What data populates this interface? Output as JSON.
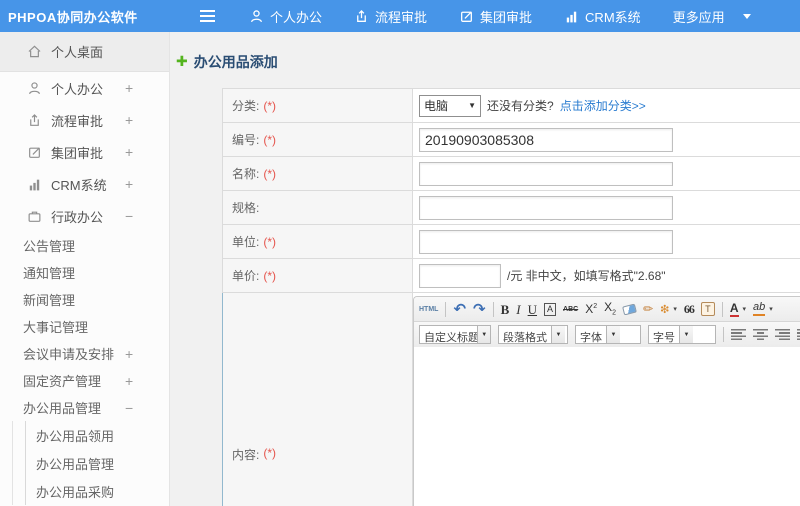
{
  "header": {
    "logo": "PHPOA协同办公软件",
    "nav": [
      {
        "label": "个人办公"
      },
      {
        "label": "流程审批"
      },
      {
        "label": "集团审批"
      },
      {
        "label": "CRM系统"
      },
      {
        "label": "更多应用"
      }
    ]
  },
  "sidebar": {
    "items": [
      {
        "label": "个人桌面",
        "expander": ""
      },
      {
        "label": "个人办公",
        "expander": "+"
      },
      {
        "label": "流程审批",
        "expander": "+"
      },
      {
        "label": "集团审批",
        "expander": "+"
      },
      {
        "label": "CRM系统",
        "expander": "+"
      },
      {
        "label": "行政办公",
        "expander": "−"
      }
    ],
    "admin_children": [
      {
        "label": "公告管理",
        "expander": ""
      },
      {
        "label": "通知管理",
        "expander": ""
      },
      {
        "label": "新闻管理",
        "expander": ""
      },
      {
        "label": "大事记管理",
        "expander": ""
      },
      {
        "label": "会议申请及安排",
        "expander": "+"
      },
      {
        "label": "固定资产管理",
        "expander": "+"
      },
      {
        "label": "办公用品管理",
        "expander": "−"
      }
    ],
    "supplies_children": [
      {
        "label": "办公用品领用"
      },
      {
        "label": "办公用品管理"
      },
      {
        "label": "办公用品采购"
      }
    ]
  },
  "form": {
    "title": "办公用品添加",
    "rows": {
      "category": {
        "label": "分类:",
        "required": "(*)",
        "select_value": "电脑",
        "hint": "还没有分类?",
        "link": "点击添加分类>>"
      },
      "code": {
        "label": "编号:",
        "required": "(*)",
        "value": "20190903085308"
      },
      "name": {
        "label": "名称:",
        "required": "(*)"
      },
      "spec": {
        "label": "规格:",
        "required": ""
      },
      "unit": {
        "label": "单位:",
        "required": "(*)"
      },
      "price": {
        "label": "单价:",
        "required": "(*)",
        "suffix": "/元 非中文，如填写格式\"2.68\""
      },
      "content": {
        "label": "内容:",
        "required": "(*)"
      }
    }
  },
  "editor": {
    "toolbar_row1": {
      "html": "HTML",
      "bold": "B",
      "italic": "I",
      "underline": "U",
      "char_border": "A",
      "strike": "ABC",
      "sup_base": "X",
      "sup_exp": "2",
      "sub_base": "X",
      "sub_exp": "2",
      "quote": "66",
      "paste_text": "T",
      "font_color": "A",
      "highlight": "ab"
    },
    "toolbar_row2": {
      "custom_title": "自定义标题",
      "paragraph": "段落格式",
      "font_family": "字体",
      "font_size": "字号"
    }
  },
  "colors": {
    "topbar_blue": "#4795e8",
    "link_blue": "#2a7cd0",
    "required_red": "#e5554d",
    "title_navy": "#2a4d73",
    "plus_green": "#54b41e"
  }
}
